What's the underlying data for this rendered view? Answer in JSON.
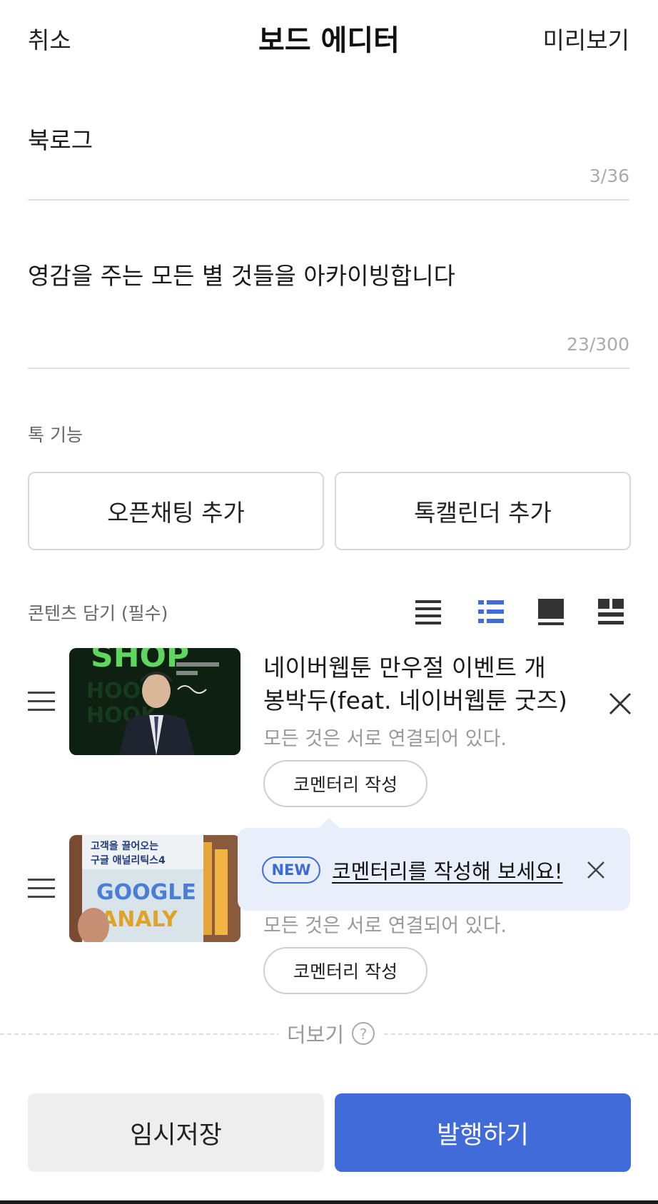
{
  "header": {
    "cancel_label": "취소",
    "title": "보드 에디터",
    "preview_label": "미리보기"
  },
  "board": {
    "title_value": "북로그",
    "title_count": "3/36",
    "description_value": "영감을 주는 모든 별 것들을 아카이빙합니다",
    "description_count": "23/300"
  },
  "talk_features": {
    "label": "톡 기능",
    "open_chat_label": "오픈채팅 추가",
    "talk_calendar_label": "톡캘린더 추가"
  },
  "contents": {
    "label": "콘텐츠 담기 (필수)",
    "view_modes": [
      {
        "icon": "list-compact-icon",
        "selected": false
      },
      {
        "icon": "list-bullet-icon",
        "selected": true
      },
      {
        "icon": "card-large-icon",
        "selected": false
      },
      {
        "icon": "grid-icon",
        "selected": false
      }
    ],
    "items": [
      {
        "title_line1": "네이버웹툰 만우절 이벤트 개",
        "title_line2": "봉박두(feat. 네이버웹툰 굿즈)",
        "subtitle": "모든 것은 서로 연결되어 있다.",
        "commentary_label": "코멘터리 작성",
        "thumbnail_text": "SHOP"
      },
      {
        "subtitle": "모든 것은 서로 연결되어 있다.",
        "commentary_label": "코멘터리 작성",
        "thumbnail_text_top": "고객을 끌어오는",
        "thumbnail_text_mid": "구글 애널리틱스4",
        "thumbnail_text_big": "GOOGLE",
        "thumbnail_text_big2": "ANALY"
      }
    ]
  },
  "tooltip": {
    "badge": "NEW",
    "text": "코멘터리를 작성해 보세요!"
  },
  "more": {
    "label": "더보기"
  },
  "footer": {
    "save_label": "임시저장",
    "publish_label": "발행하기"
  },
  "colors": {
    "accent": "#416bd8",
    "tooltip_bg": "#e8eefa"
  }
}
